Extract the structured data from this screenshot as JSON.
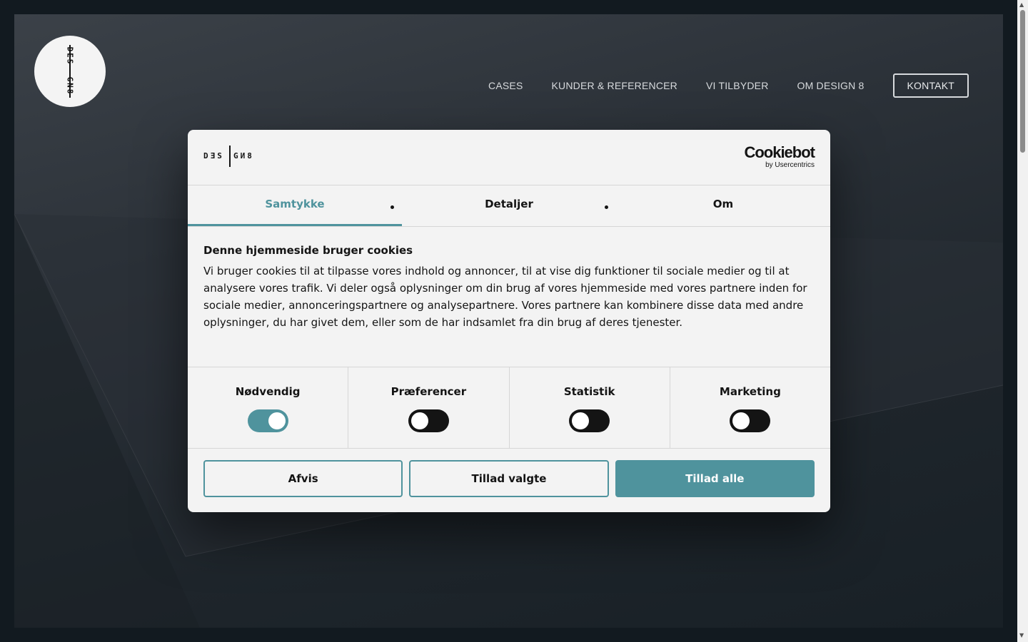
{
  "site": {
    "logo_text_top": "DES",
    "logo_text_bottom": "GN8",
    "nav": {
      "items": [
        "CASES",
        "KUNDER & REFERENCER",
        "VI TILBYDER",
        "OM DESIGN 8"
      ],
      "contact_label": "KONTAKT"
    }
  },
  "dialog": {
    "brand_left": "DƎS",
    "brand_right": "GИ8",
    "cookiebot_main": "Cookiebot",
    "cookiebot_sub": "by Usercentrics",
    "tabs": [
      {
        "label": "Samtykke",
        "active": true
      },
      {
        "label": "Detaljer",
        "active": false
      },
      {
        "label": "Om",
        "active": false
      }
    ],
    "heading": "Denne hjemmeside bruger cookies",
    "text": "Vi bruger cookies til at tilpasse vores indhold og annoncer, til at vise dig funktioner til sociale medier og til at analysere vores trafik. Vi deler også oplysninger om din brug af vores hjemmeside med vores partnere inden for sociale medier, annonceringspartnere og analysepartnere. Vores partnere kan kombinere disse data med andre oplysninger, du har givet dem, eller som de har indsamlet fra din brug af deres tjenester.",
    "toggles": [
      {
        "label": "Nødvendig",
        "on": true
      },
      {
        "label": "Præferencer",
        "on": false
      },
      {
        "label": "Statistik",
        "on": false
      },
      {
        "label": "Marketing",
        "on": false
      }
    ],
    "buttons": {
      "reject": "Afvis",
      "allow_selected": "Tillad valgte",
      "allow_all": "Tillad alle"
    }
  },
  "colors": {
    "accent": "#4f939d",
    "dialog_bg": "#f3f3f3",
    "page_bg": "#121a20"
  },
  "icons": [
    "design8-logo",
    "cookiebot-logo"
  ]
}
